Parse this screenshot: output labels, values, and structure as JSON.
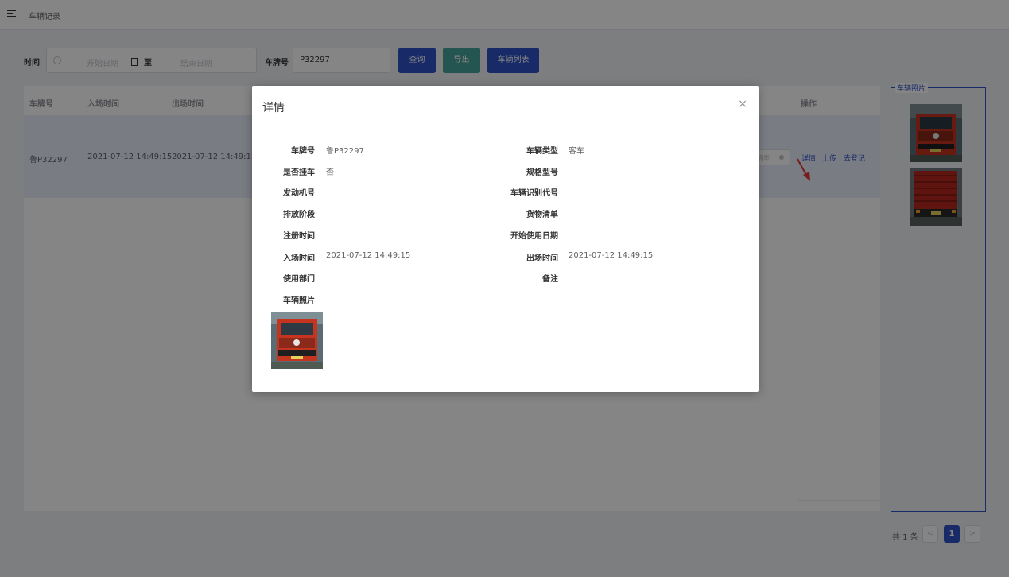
{
  "header": {
    "breadcrumb": "车辆记录",
    "menu_icon": "menu-fold-icon"
  },
  "filter": {
    "time_label": "时间",
    "start_placeholder": "开始日期",
    "range_sep": "至",
    "end_placeholder": "结束日期",
    "plate_label": "车牌号",
    "plate_value": "P32297",
    "query_label": "查询",
    "export_label": "导出",
    "vehicle_list_label": "车辆列表"
  },
  "table": {
    "columns": [
      "车牌号",
      "入场时间",
      "出场时间",
      "操作"
    ],
    "row": {
      "plate": "鲁P32297",
      "in_time": "2021-07-12 14:49:15",
      "out_time": "2021-07-12 14:49:15",
      "state_text": "请奉"
    },
    "actions": [
      "详情",
      "上传",
      "去登记"
    ]
  },
  "photos_panel": {
    "title": "车辆照片"
  },
  "pagination": {
    "total": "共 1 条",
    "prev": "<",
    "current": "1",
    "next": ">"
  },
  "dialog": {
    "title": "详情",
    "close": "×",
    "left": [
      {
        "label": "车牌号",
        "value": "鲁P32297"
      },
      {
        "label": "是否挂车",
        "value": "否"
      },
      {
        "label": "发动机号",
        "value": ""
      },
      {
        "label": "排放阶段",
        "value": ""
      },
      {
        "label": "注册时间",
        "value": ""
      },
      {
        "label": "入场时间",
        "value": "2021-07-12 14:49:15"
      },
      {
        "label": "使用部门",
        "value": ""
      },
      {
        "label": "车辆照片",
        "value": ""
      }
    ],
    "right": [
      {
        "label": "车辆类型",
        "value": "客车"
      },
      {
        "label": "规格型号",
        "value": ""
      },
      {
        "label": "车辆识别代号",
        "value": ""
      },
      {
        "label": "货物清单",
        "value": ""
      },
      {
        "label": "开始使用日期",
        "value": ""
      },
      {
        "label": "出场时间",
        "value": "2021-07-12 14:49:15"
      },
      {
        "label": "备注",
        "value": ""
      }
    ]
  },
  "colors": {
    "primary": "#3152c7",
    "export": "#45a39a",
    "annotation_arrow": "#e53935",
    "row_highlight": "#e8eefb"
  }
}
